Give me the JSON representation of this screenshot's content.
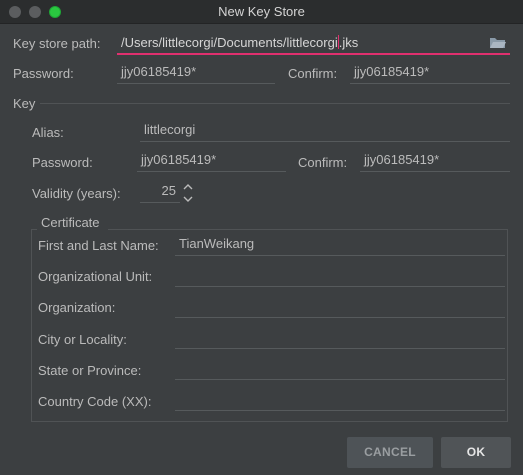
{
  "window": {
    "title": "New Key Store"
  },
  "keystore": {
    "path_label": "Key store path:",
    "path_value_before_caret": "/Users/littlecorgi/Documents/littlecorgi",
    "path_value_after_caret": ".jks",
    "password_label": "Password:",
    "password_value": "jjy06185419*",
    "confirm_label": "Confirm:",
    "confirm_value": "jjy06185419*"
  },
  "key": {
    "section_label": "Key",
    "alias_label": "Alias:",
    "alias_value": "littlecorgi",
    "password_label": "Password:",
    "password_value": "jjy06185419*",
    "confirm_label": "Confirm:",
    "confirm_value": "jjy06185419*",
    "validity_label": "Validity (years):",
    "validity_value": "25"
  },
  "certificate": {
    "section_label": "Certificate",
    "name_label": "First and Last Name:",
    "name_value": "TianWeikang",
    "org_unit_label": "Organizational Unit:",
    "org_unit_value": "",
    "org_label": "Organization:",
    "org_value": "",
    "city_label": "City or Locality:",
    "city_value": "",
    "state_label": "State or Province:",
    "state_value": "",
    "country_label": "Country Code (XX):",
    "country_value": ""
  },
  "buttons": {
    "cancel": "CANCEL",
    "ok": "OK"
  },
  "colors": {
    "background": "#3c3f41",
    "accent": "#e0306f",
    "text": "#bbbbbb"
  },
  "icons": {
    "browse": "folder-icon",
    "spinner": "up-down-chevron-icon"
  }
}
